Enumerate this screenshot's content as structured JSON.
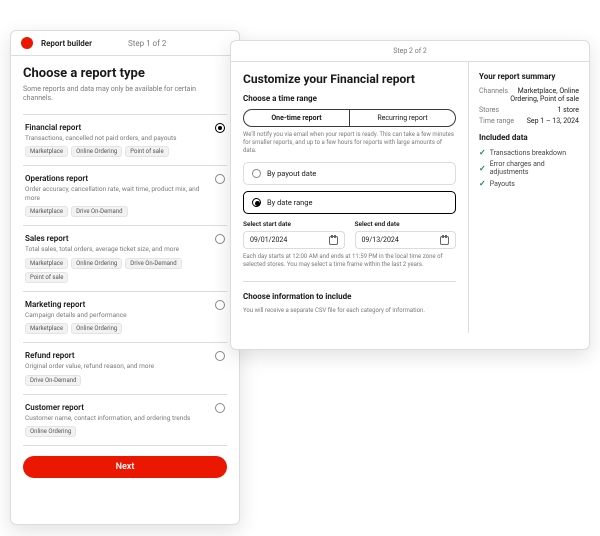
{
  "left": {
    "header": {
      "title": "Report builder",
      "step": "Step 1 of 2"
    },
    "heading": "Choose a report type",
    "subheading": "Some reports and data may only be available for certain channels.",
    "types": [
      {
        "title": "Financial report",
        "desc": "Transactions, cancelled not paid orders, and payouts",
        "selected": true,
        "chips": [
          "Marketplace",
          "Online Ordering",
          "Point of sale"
        ]
      },
      {
        "title": "Operations report",
        "desc": "Order accuracy, cancellation rate, wait time, product mix, and more",
        "selected": false,
        "chips": [
          "Marketplace",
          "Drive On-Demand"
        ]
      },
      {
        "title": "Sales report",
        "desc": "Total sales, total orders, average ticket size, and more",
        "selected": false,
        "chips": [
          "Marketplace",
          "Online Ordering",
          "Drive On-Demand",
          "Point of sale"
        ]
      },
      {
        "title": "Marketing report",
        "desc": "Campaign details and performance",
        "selected": false,
        "chips": [
          "Marketplace",
          "Online Ordering"
        ]
      },
      {
        "title": "Refund report",
        "desc": "Original order value, refund reason, and more",
        "selected": false,
        "chips": [
          "Drive On-Demand"
        ]
      },
      {
        "title": "Customer report",
        "desc": "Customer name, contact information, and ordering trends",
        "selected": false,
        "chips": [
          "Online Ordering"
        ]
      }
    ],
    "next": "Next"
  },
  "right": {
    "step": "Step 2 of 2",
    "title": "Customize your Financial report",
    "range_heading": "Choose a time range",
    "seg": {
      "one": "One-time report",
      "rec": "Recurring report",
      "selected": "one"
    },
    "notify": "We'll notify you via email when your report is ready. This can take a few minutes for smaller reports, and up to a few hours for reports with large amounts of data.",
    "opts": {
      "payout": "By payout date",
      "date": "By date range",
      "selected": "date"
    },
    "dates": {
      "start_label": "Select start date",
      "end_label": "Select end date",
      "start": "09/01/2024",
      "end": "09/13/2024",
      "footnote": "Each day starts at 12:00 AM and ends at 11:59 PM in the local time zone of selected stores. You may select a time frame within the last 2 years."
    },
    "info_heading": "Choose information to include",
    "info_sub": "You will receive a separate CSV file for each category of information.",
    "summary": {
      "title": "Your report summary",
      "rows": [
        {
          "k": "Channels",
          "v": "Marketplace, Online Ordering, Point of sale"
        },
        {
          "k": "Stores",
          "v": "1 store"
        },
        {
          "k": "Time range",
          "v": "Sep 1 – 13, 2024"
        }
      ],
      "included_title": "Included data",
      "included": [
        "Transactions breakdown",
        "Error charges and adjustments",
        "Payouts"
      ]
    }
  }
}
